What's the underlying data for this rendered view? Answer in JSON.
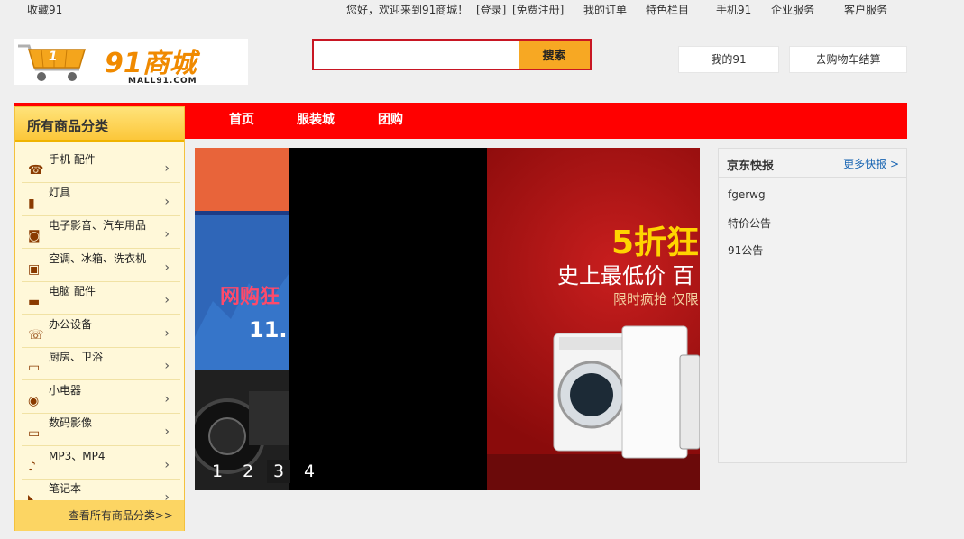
{
  "topbar": {
    "favorite": "收藏91",
    "greeting": "您好，欢迎来到91商城！",
    "login": "[登录]",
    "register": "[免费注册]",
    "my_orders": "我的订单",
    "featured": "特色栏目",
    "mobile": "手机91",
    "enterprise": "企业服务",
    "support": "客户服务"
  },
  "logo": {
    "text": "91商城",
    "subtext": "MALL91.COM"
  },
  "search": {
    "value": "",
    "placeholder": "",
    "button": "搜索"
  },
  "header": {
    "my91": "我的91",
    "cart": "去购物车结算"
  },
  "nav": {
    "items": [
      "首页",
      "服装城",
      "团购"
    ]
  },
  "categories": {
    "title": "所有商品分类",
    "items": [
      {
        "label": "手机 配件",
        "icon": "phone-icon"
      },
      {
        "label": "灯具",
        "icon": "mobile-icon"
      },
      {
        "label": "电子影音、汽车用品",
        "icon": "camera-icon"
      },
      {
        "label": "空调、冰箱、洗衣机",
        "icon": "appliance-icon"
      },
      {
        "label": "电脑 配件",
        "icon": "computer-icon"
      },
      {
        "label": "办公设备",
        "icon": "office-phone-icon"
      },
      {
        "label": "厨房、卫浴",
        "icon": "tv-icon"
      },
      {
        "label": "小电器",
        "icon": "speaker-icon"
      },
      {
        "label": "数码影像",
        "icon": "monitor-icon"
      },
      {
        "label": "MP3、MP4",
        "icon": "player-icon"
      },
      {
        "label": "笔记本",
        "icon": "shoe-icon"
      }
    ],
    "all_link": "查看所有商品分类>>"
  },
  "banner": {
    "promo_title": "5折狂",
    "promo_subtitle": "史上最低价 百",
    "promo_sub2": "限时疯抢 仅限",
    "left_promo": "网购狂",
    "left_date": "11.",
    "slides": [
      "1",
      "2",
      "3",
      "4"
    ],
    "active_slide": 3
  },
  "news": {
    "title": "京东快报",
    "more": "更多快报 >",
    "items": [
      "fgerwg",
      "特价公告",
      "91公告"
    ]
  },
  "colors": {
    "nav_red": "#ff0000",
    "accent_yellow": "#f7a823",
    "category_bg": "#fff8d9",
    "link_blue": "#1a66b3"
  }
}
